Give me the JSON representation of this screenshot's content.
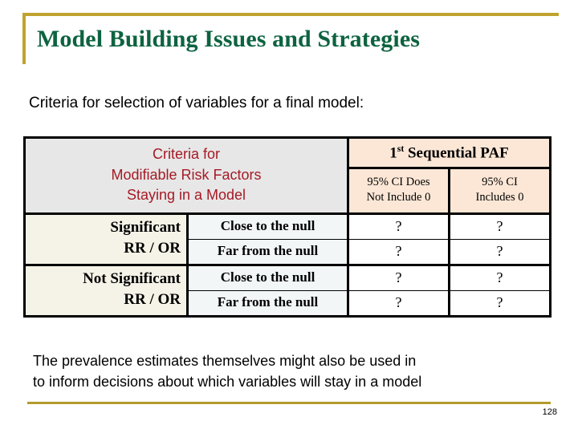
{
  "slide": {
    "title": "Model Building Issues and Strategies",
    "subtitle": "Criteria for selection of variables for a final model:",
    "page_number": "128",
    "accent_gold": "#c0a32e",
    "title_green": "#0d6340",
    "header_red": "#a51a25"
  },
  "table": {
    "header": {
      "left": {
        "line1": "Criteria for",
        "line2": "Modifiable Risk Factors",
        "line3": "Staying in a Model"
      },
      "paf_group": "1st Sequential PAF",
      "paf_group_base": "1",
      "paf_group_sup": "st",
      "paf_group_rest": " Sequential PAF",
      "ci_columns": [
        {
          "line1": "95% CI Does",
          "line2": "Not Include 0"
        },
        {
          "line1": "95% CI",
          "line2": "Includes 0"
        }
      ]
    },
    "groups": [
      {
        "label_line1": "Significant",
        "label_line2": "RR / OR",
        "rows": [
          {
            "magnitude": "Close to the null",
            "ci_not_include_0": "?",
            "ci_includes_0": "?"
          },
          {
            "magnitude": "Far from the null",
            "ci_not_include_0": "?",
            "ci_includes_0": "?"
          }
        ]
      },
      {
        "label_line1": "Not Significant",
        "label_line2": "RR / OR",
        "rows": [
          {
            "magnitude": "Close to the null",
            "ci_not_include_0": "?",
            "ci_includes_0": "?"
          },
          {
            "magnitude": "Far from the null",
            "ci_not_include_0": "?",
            "ci_includes_0": "?"
          }
        ]
      }
    ]
  },
  "footer": {
    "line1": "The prevalence estimates themselves might also be used in",
    "line2": "to inform decisions about which variables will stay in a model"
  }
}
